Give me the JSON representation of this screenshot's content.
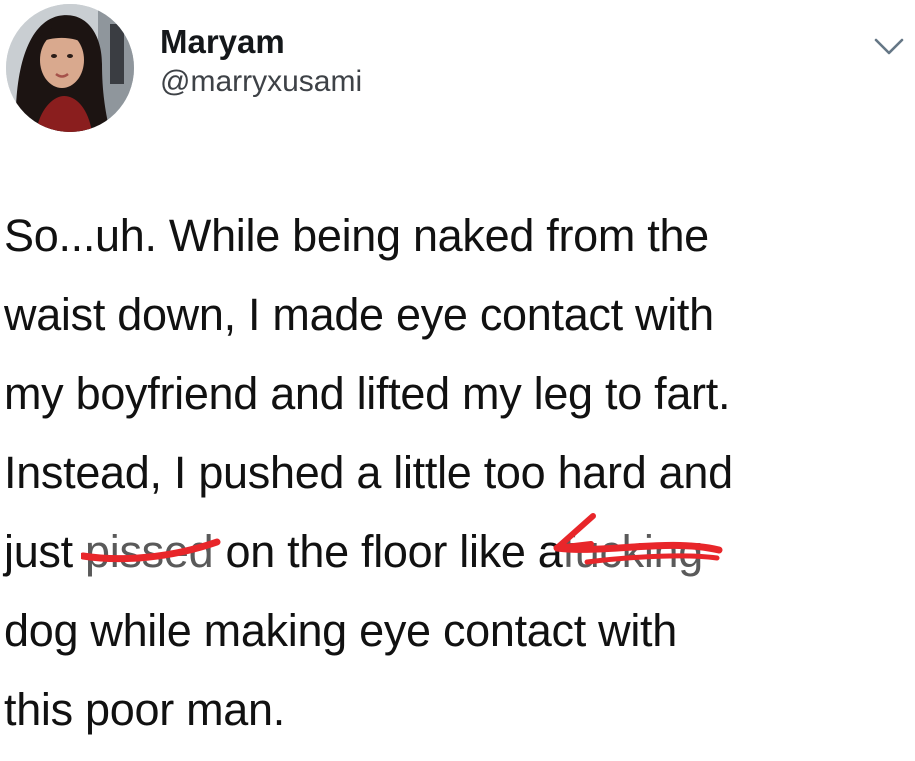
{
  "tweet": {
    "author": {
      "display_name": "Maryam",
      "handle": "@marryxusami"
    },
    "menu_icon": "chevron-down-icon",
    "body": {
      "line1": "So...uh. While being naked from the",
      "line2": "waist down, I made eye contact with",
      "line3": "my boyfriend and lifted my leg to fart.",
      "line4": "Instead, I pushed a little too hard and",
      "line5_a": "just ",
      "line5_censored_1": "pissed",
      "line5_b": " on the floor like a",
      "line5_censored_2": "fucking",
      "line6": "dog while making eye contact with",
      "line7": "this poor man."
    },
    "censor_color": "#e8262a"
  }
}
